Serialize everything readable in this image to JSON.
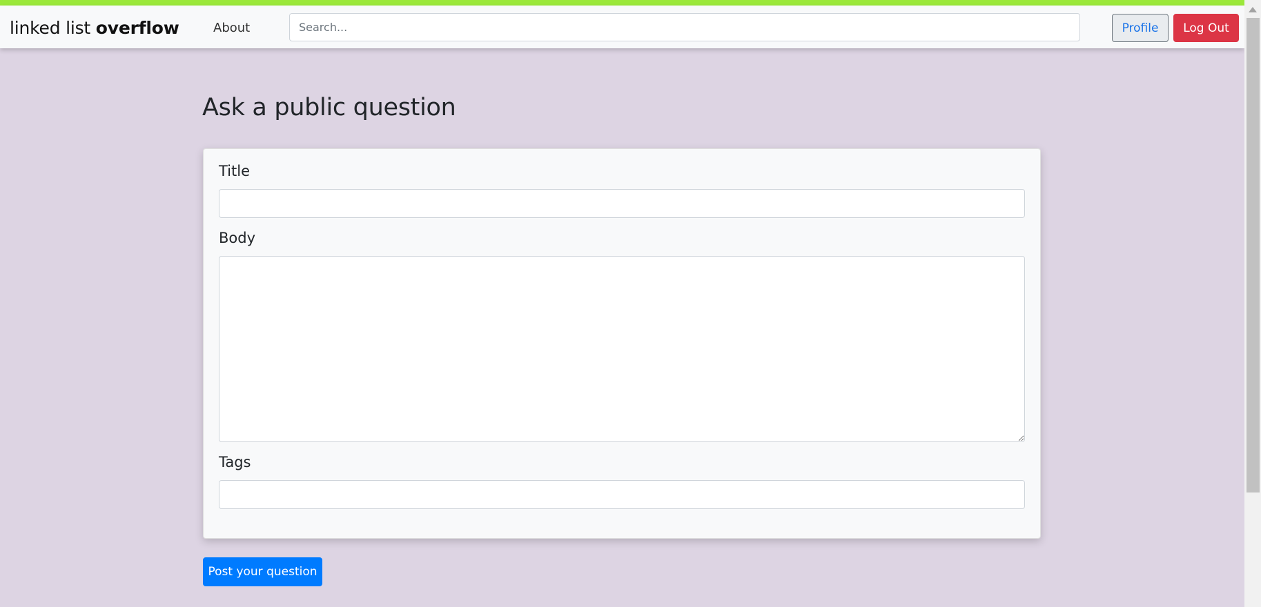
{
  "navbar": {
    "brand_light": "linked list",
    "brand_bold": "overflow",
    "about_label": "About",
    "search_placeholder": "Search...",
    "profile_label": "Profile",
    "logout_label": "Log Out"
  },
  "main": {
    "heading": "Ask a public question",
    "form": {
      "title_label": "Title",
      "title_value": "",
      "body_label": "Body",
      "body_value": "",
      "tags_label": "Tags",
      "tags_value": ""
    },
    "submit_label": "Post your question"
  },
  "colors": {
    "top_stripe": "#9be83a",
    "page_background": "#ddd4e3",
    "logout_button": "#dc3545",
    "post_button": "#007bff",
    "profile_text": "#1a73e8"
  }
}
